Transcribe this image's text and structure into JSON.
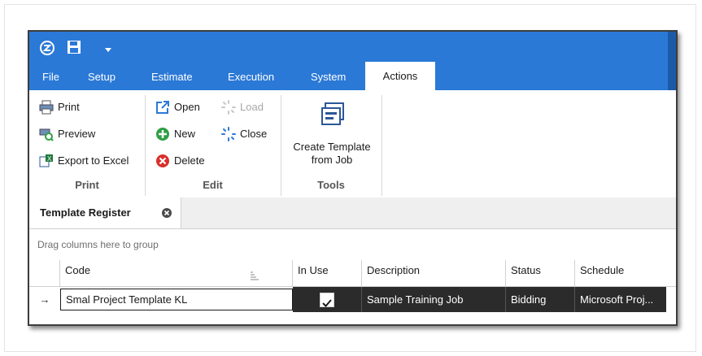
{
  "menu": {
    "tabs": [
      {
        "label": "File"
      },
      {
        "label": "Setup"
      },
      {
        "label": "Estimate"
      },
      {
        "label": "Execution"
      },
      {
        "label": "System"
      },
      {
        "label": "Actions"
      }
    ],
    "active_tab": "Actions"
  },
  "ribbon": {
    "print_group": {
      "label": "Print",
      "buttons": [
        {
          "label": "Print",
          "icon": "printer-icon"
        },
        {
          "label": "Preview",
          "icon": "print-preview-icon"
        },
        {
          "label": "Export to Excel",
          "icon": "excel-export-icon"
        }
      ]
    },
    "edit_group": {
      "label": "Edit",
      "buttons": [
        {
          "label": "Open",
          "icon": "open-external-icon"
        },
        {
          "label": "Load",
          "icon": "spinner-icon",
          "enabled": false
        },
        {
          "label": "New",
          "icon": "add-icon"
        },
        {
          "label": "Close",
          "icon": "spinner-icon"
        },
        {
          "label": "Delete",
          "icon": "delete-icon"
        }
      ]
    },
    "tools_group": {
      "label": "Tools",
      "buttons": [
        {
          "label_line1": "Create Template",
          "label_line2": "from Job",
          "icon": "template-icon"
        }
      ]
    }
  },
  "document_tab": {
    "label": "Template Register",
    "close_icon": "close-icon"
  },
  "grid": {
    "group_hint": "Drag columns here to group",
    "columns": [
      "Code",
      "In Use",
      "Description",
      "Status",
      "Schedule"
    ],
    "rows": [
      {
        "code": "Smal Project Template KL",
        "in_use": true,
        "description": "Sample Training Job",
        "status": "Bidding",
        "schedule": "Microsoft Proj..."
      }
    ]
  },
  "colors": {
    "accent": "#2b79d6",
    "selected_row": "#2b2b2b"
  }
}
